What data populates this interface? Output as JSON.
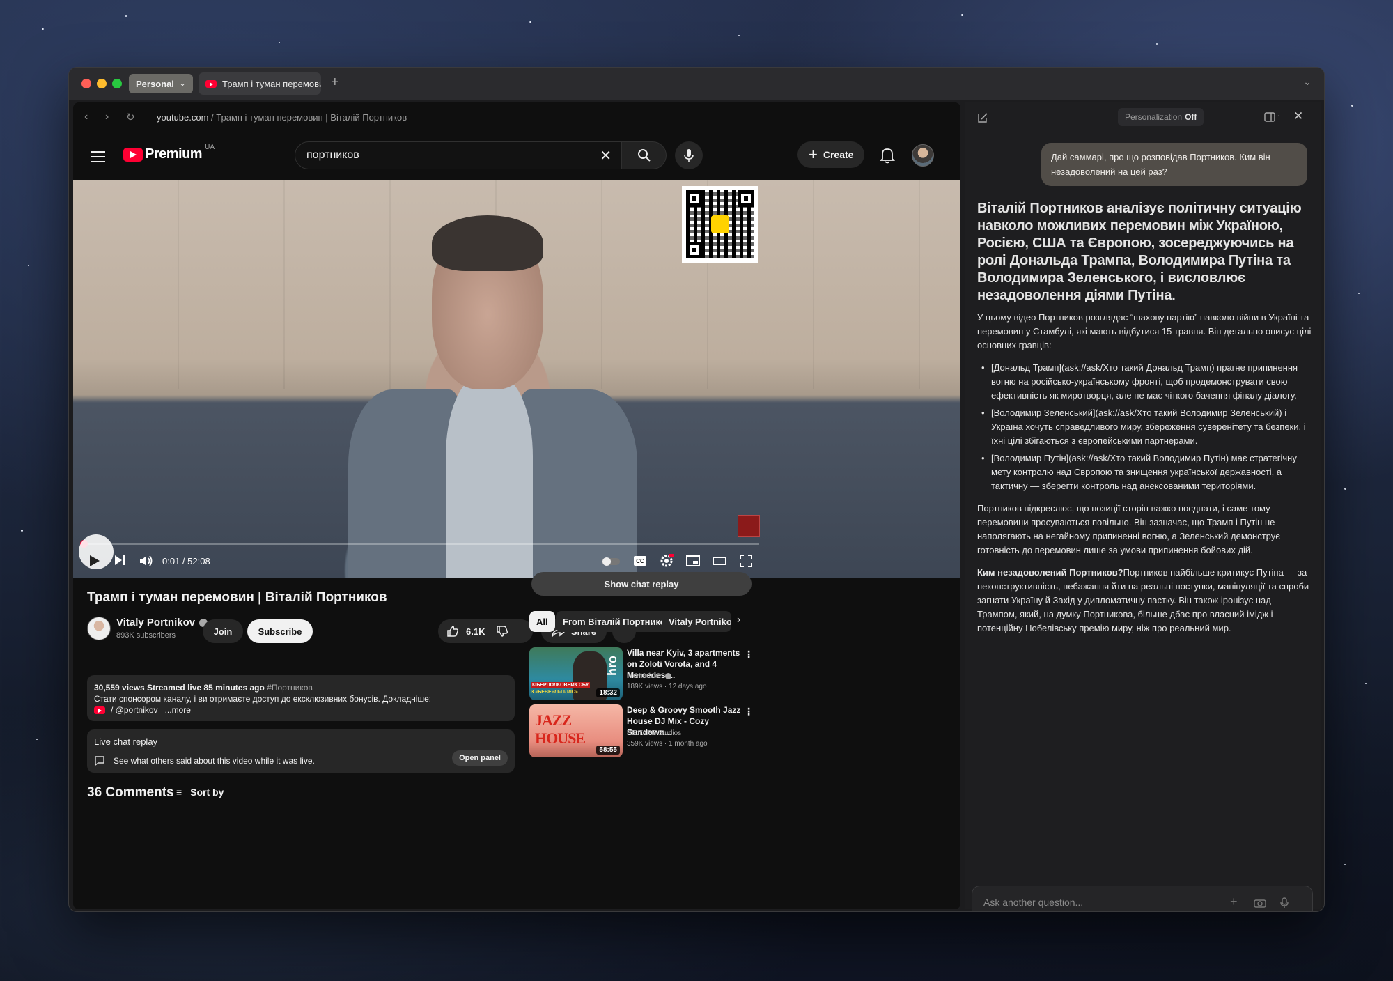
{
  "browser": {
    "profile": "Personal",
    "tab_title": "Трамп і туман перемовин",
    "url_host": "youtube.com",
    "url_path": " / Трамп і туман перемовин | Віталій Портников"
  },
  "youtube": {
    "logo_word": "Premium",
    "country_code": "UA",
    "search_value": "портников",
    "create_label": "Create"
  },
  "player": {
    "time": "0:01 / 52:08",
    "progress_fraction": 0.0003
  },
  "video": {
    "title": "Трамп і туман перемовин | Віталій Портников",
    "channel": "Vitaly Portnikov",
    "subscribers": "893K subscribers",
    "join_label": "Join",
    "subscribe_label": "Subscribe",
    "likes": "6.1K",
    "share_label": "Share",
    "description": {
      "meta": "30,559 views  Streamed live 85 minutes ago",
      "hashtag": "#Портников",
      "text": "Стати спонсором каналу, і ви отримаєте доступ до ексклюзивних бонусів. Докладніше:",
      "link": "/ @portnikov",
      "more": "...more"
    },
    "live_chat": {
      "title": "Live chat replay",
      "text": "See what others said about this video while it was live.",
      "button": "Open panel"
    },
    "comments_count": "36 Comments",
    "sort_label": "Sort by"
  },
  "sidebar": {
    "show_chat": "Show chat replay",
    "chips": [
      "All",
      "From Віталій Портников",
      "Vitaly Portnikov"
    ],
    "recommendations": [
      {
        "title": "Villa near Kyiv, 3 apartments on Zoloti Vorota, and 4 Mercedes:...",
        "channel": "hromadske",
        "meta": "189K views · 12 days ago",
        "duration": "18:32",
        "thumb_text": "КІБЕРПОЛКОВНИК СБУ",
        "thumb_sub": "З «БЕВЕРЛІ-ГІЛЛС»"
      },
      {
        "title": "Deep & Groovy Smooth Jazz House DJ Mix - Cozy Sundown...",
        "channel": "RE:TAPE Studios",
        "meta": "359K views · 1 month ago",
        "duration": "58:55",
        "thumb_text": "JAZZ HOUSE"
      }
    ]
  },
  "assistant": {
    "personalization_label": "Personalization",
    "personalization_value": "Off",
    "user_message": "Дай саммарі, про що розповідав Портников. Ким він незадоволений на цей раз?",
    "heading": "Віталій Портников аналізує політичну ситуацію навколо можливих перемовин між Україною, Росією, США та Європою, зосереджуючись на ролі Дональда Трампа, Володимира Путіна та Володимира Зеленського, і висловлює незадоволення діями Путіна.",
    "intro": "У цьому відео Портников розглядає “шахову партію” навколо війни в Україні та перемовин у Стамбулі, які мають відбутися 15 травня. Він детально описує цілі основних гравців:",
    "bullets": [
      "[Дональд Трамп](ask://ask/Хто такий Дональд Трамп) прагне припинення вогню на російсько-українському фронті, щоб продемонструвати свою ефективність як миротворця, але не має чіткого бачення фіналу діалогу.",
      "[Володимир Зеленський](ask://ask/Хто такий Володимир Зеленський) і Україна хочуть справедливого миру, збереження суверенітету та безпеки, і їхні цілі збігаються з європейськими партнерами.",
      "[Володимир Путін](ask://ask/Хто такий Володимир Путін) має стратегічну мету контролю над Європою та знищення української державності, а тактичну — зберегти контроль над анексованими територіями."
    ],
    "para2": "Портников підкреслює, що позиції сторін важко поєднати, і саме тому перемовини просуваються повільно. Він зазначає, що Трамп і Путін не наполягають на негайному припиненні вогню, а Зеленський демонструє готовність до перемовин лише за умови припинення бойових дій.",
    "para3_bold": "Ким незадоволений Портников?",
    "para3": "Портников найбільше критикує Путіна — за неконструктивність, небажання йти на реальні поступки, маніпуляції та спроби загнати Україну й Захід у дипломатичну пастку. Він також іронізує над Трампом, який, на думку Портникова, більше дбає про власний імідж і потенційну Нобелівську премію миру, ніж про реальний мир.",
    "ask_placeholder": "Ask another question..."
  }
}
